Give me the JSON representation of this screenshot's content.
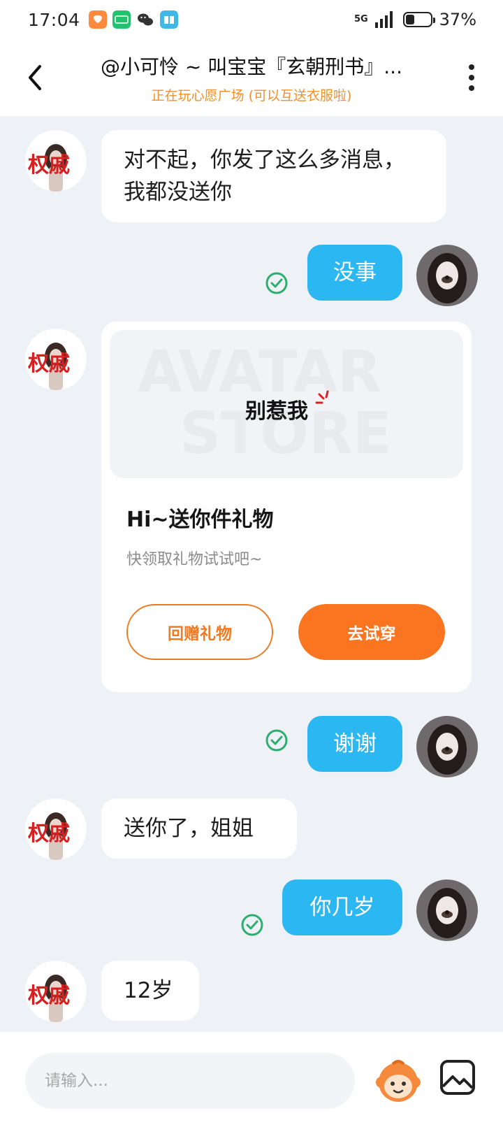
{
  "status_bar": {
    "time": "17:04",
    "network": "5G",
    "battery_percent": "37%",
    "battery_level": 0.37
  },
  "header": {
    "title": "@小可怜 ~ 叫宝宝『玄朝刑书』...",
    "subtitle": "正在玩心愿广场 (可以互送衣服啦)"
  },
  "messages": [
    {
      "side": "in",
      "text": "对不起，你发了这么多消息，我都没送你"
    },
    {
      "side": "out",
      "text": "没事",
      "sent": true
    },
    {
      "side": "in",
      "type": "gift"
    },
    {
      "side": "out",
      "text": "谢谢",
      "sent": true
    },
    {
      "side": "in",
      "text": "送你了，姐姐"
    },
    {
      "side": "out",
      "text": "你几岁",
      "sent": true
    },
    {
      "side": "in",
      "text": "12岁"
    }
  ],
  "gift_card": {
    "sticker_text": "别惹我",
    "watermark_line1": "AVATAR",
    "watermark_line2": "STORE",
    "title": "Hi~送你件礼物",
    "description": "快领取礼物试试吧~",
    "return_button": "回赠礼物",
    "try_button": "去试穿"
  },
  "contact_avatar_text": "权戚",
  "input": {
    "placeholder": "请输入..."
  },
  "colors": {
    "outgoing_bubble": "#2bb7f2",
    "accent_orange": "#fb7420",
    "subtitle_orange": "#f0902a",
    "sent_check_green": "#2cae6f"
  }
}
